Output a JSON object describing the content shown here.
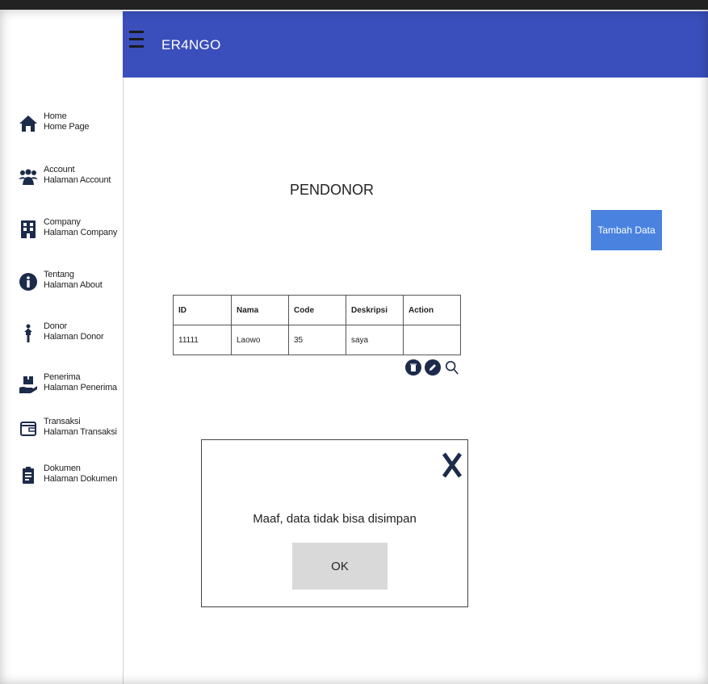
{
  "header": {
    "app_title": "ER4NGO",
    "menu_icon": "hamburger-icon",
    "color": "#3a4fbc"
  },
  "sidebar": {
    "items": [
      {
        "title": "Home",
        "subtitle": "Home Page",
        "icon": "home-icon"
      },
      {
        "title": "Account",
        "subtitle": "Halaman Account",
        "icon": "users-icon"
      },
      {
        "title": "Company",
        "subtitle": "Halaman Company",
        "icon": "building-icon"
      },
      {
        "title": "Tentang",
        "subtitle": "Halaman About",
        "icon": "info-icon"
      },
      {
        "title": "Donor",
        "subtitle": "Halaman Donor",
        "icon": "person-up-icon"
      },
      {
        "title": "Penerima",
        "subtitle": "Halaman Penerima",
        "icon": "hand-box-icon"
      },
      {
        "title": "Transaksi",
        "subtitle": "Halaman Transaksi",
        "icon": "wallet-icon"
      },
      {
        "title": "Dokumen",
        "subtitle": "Halaman Dokumen",
        "icon": "document-icon"
      }
    ]
  },
  "main": {
    "page_title": "PENDONOR",
    "add_button": "Tambah Data",
    "add_button_color": "#4a82e0",
    "table": {
      "headers": [
        "ID",
        "Nama",
        "Code",
        "Deskripsi",
        "Action"
      ],
      "rows": [
        [
          "11111",
          "Laowo",
          "35",
          "saya",
          ""
        ]
      ]
    }
  },
  "dialog": {
    "message": "Maaf, data tidak bisa disimpan",
    "ok_label": "OK",
    "close_icon": "close-icon"
  }
}
